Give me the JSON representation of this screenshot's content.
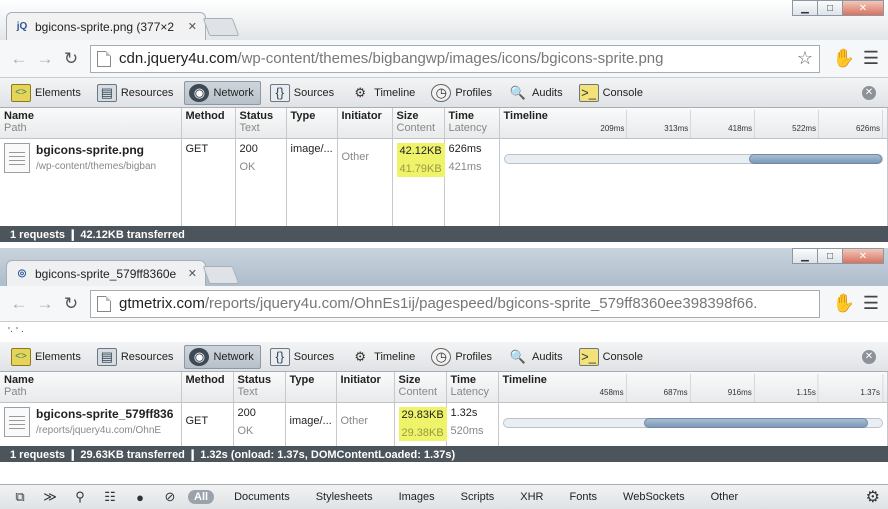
{
  "browser1": {
    "tab_favicon": "jQ",
    "tab_title": "bgicons-sprite.png (377×2",
    "url_host": "cdn.jquery4u.com",
    "url_path": "/wp-content/themes/bigbangwp/images/icons/bgicons-sprite.png",
    "devtools_tabs": [
      "Elements",
      "Resources",
      "Network",
      "Sources",
      "Timeline",
      "Profiles",
      "Audits",
      "Console"
    ],
    "selected_tab": "Network",
    "columns": {
      "name": "Name",
      "name_sub": "Path",
      "method": "Method",
      "status": "Status",
      "status_sub": "Text",
      "type": "Type",
      "initiator": "Initiator",
      "size": "Size",
      "size_sub": "Content",
      "time": "Time",
      "time_sub": "Latency",
      "timeline": "Timeline"
    },
    "timeline_ticks": [
      "209ms",
      "313ms",
      "418ms",
      "522ms",
      "626ms"
    ],
    "row": {
      "name": "bgicons-sprite.png",
      "path": "/wp-content/themes/bigban",
      "method": "GET",
      "status": "200",
      "status_text": "OK",
      "type": "image/...",
      "initiator": "Other",
      "size": "42.12KB",
      "content": "41.79KB",
      "time": "626ms",
      "latency": "421ms",
      "timeline_start": 0.647,
      "timeline_end": 1.0
    },
    "status_bar": "1 requests  ❙  42.12KB transferred"
  },
  "browser2": {
    "tab_title": "bgicons-sprite_579ff8360e",
    "url_host": "gtmetrix.com",
    "url_path": "/reports/jquery4u.com/OhnEs1ij/pagespeed/bgicons-sprite_579ff8360ee398398f66.",
    "extra_text": "'· ' ·",
    "devtools_tabs": [
      "Elements",
      "Resources",
      "Network",
      "Sources",
      "Timeline",
      "Profiles",
      "Audits",
      "Console"
    ],
    "selected_tab": "Network",
    "columns": {
      "name": "Name",
      "name_sub": "Path",
      "method": "Method",
      "status": "Status",
      "status_sub": "Text",
      "type": "Type",
      "initiator": "Initiator",
      "size": "Size",
      "size_sub": "Content",
      "time": "Time",
      "time_sub": "Latency",
      "timeline": "Timeline"
    },
    "timeline_ticks": [
      "458ms",
      "687ms",
      "916ms",
      "1.15s",
      "1.37s"
    ],
    "row": {
      "name": "bgicons-sprite_579ff836",
      "path": "/reports/jquery4u.com/OhnE",
      "method": "GET",
      "status": "200",
      "status_text": "OK",
      "type": "image/...",
      "initiator": "Other",
      "size": "29.83KB",
      "content": "29.38KB",
      "time": "1.32s",
      "latency": "520ms",
      "timeline_start": 0.372,
      "timeline_end": 0.962
    },
    "status_bar": "1 requests  ❙  29.63KB transferred  ❙  1.32s (onload: 1.37s, DOMContentLoaded: 1.37s)"
  },
  "bottom_bar": {
    "filters": [
      "All",
      "Documents",
      "Stylesheets",
      "Images",
      "Scripts",
      "XHR",
      "Fonts",
      "WebSockets",
      "Other"
    ],
    "selected_filter": "All",
    "icons": [
      "dock-icon",
      "console-drawer-icon",
      "search-icon",
      "list-view-icon",
      "record-icon",
      "clear-icon"
    ]
  }
}
